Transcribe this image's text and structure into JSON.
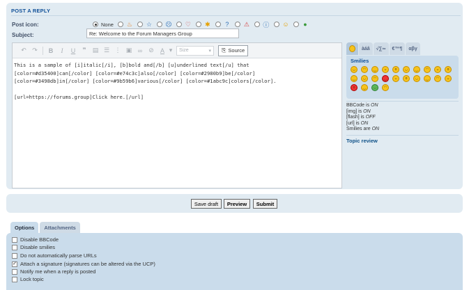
{
  "panel": {
    "title": "POST A REPLY",
    "post_icon_label": "Post icon:",
    "none_label": "None",
    "subject_label": "Subject:",
    "subject_value": "Re: Welcome to the Forum Managers Group",
    "icons": [
      "fire-icon",
      "star-icon",
      "sad-icon",
      "heart-icon",
      "sun-icon",
      "question-icon",
      "warning-icon",
      "info-icon",
      "smile-icon",
      "thumbs-icon"
    ]
  },
  "editor": {
    "size_label": "Size",
    "source_label": "Source",
    "content": "This is a sample of [i]italic[/i], [b]bold and[/b] [u]underlined text[/u] that\n[color=#d35400]can[/color] [color=#e74c3c]also[/color] [color=#2980b9]be[/color]\n[color=#3498db]in[/color] [color=#9b59b6]various[/color] [color=#1abc9c]colors[/color].\n\n[url=https://forums.group]Click here.[/url]"
  },
  "side": {
    "tabs": [
      "☺",
      "àáâ",
      "√∑∞",
      "€™¶",
      "αβγ"
    ],
    "smilies_title": "Smilies",
    "smilies_count": 24,
    "status": [
      {
        "label": "BBCode is ",
        "value": "ON"
      },
      {
        "label": "[img] is ",
        "value": "ON"
      },
      {
        "label": "[flash] is ",
        "value": "OFF"
      },
      {
        "label": "[url] is ",
        "value": "ON"
      },
      {
        "label": "Smilies are ",
        "value": "ON"
      }
    ],
    "topic_review": "Topic review"
  },
  "buttons": {
    "save_draft": "Save draft",
    "preview": "Preview",
    "submit": "Submit"
  },
  "tabs": {
    "options": "Options",
    "attachments": "Attachments"
  },
  "options": [
    {
      "label": "Disable BBCode",
      "checked": false
    },
    {
      "label": "Disable smilies",
      "checked": false
    },
    {
      "label": "Do not automatically parse URLs",
      "checked": false
    },
    {
      "label": "Attach a signature (signatures can be altered via the UCP)",
      "checked": true
    },
    {
      "label": "Notify me when a reply is posted",
      "checked": false
    },
    {
      "label": "Lock topic",
      "checked": false
    }
  ],
  "colors": {
    "panel_bg": "#e1ebf2",
    "accent": "#115098",
    "options_bg": "#cadceb"
  }
}
